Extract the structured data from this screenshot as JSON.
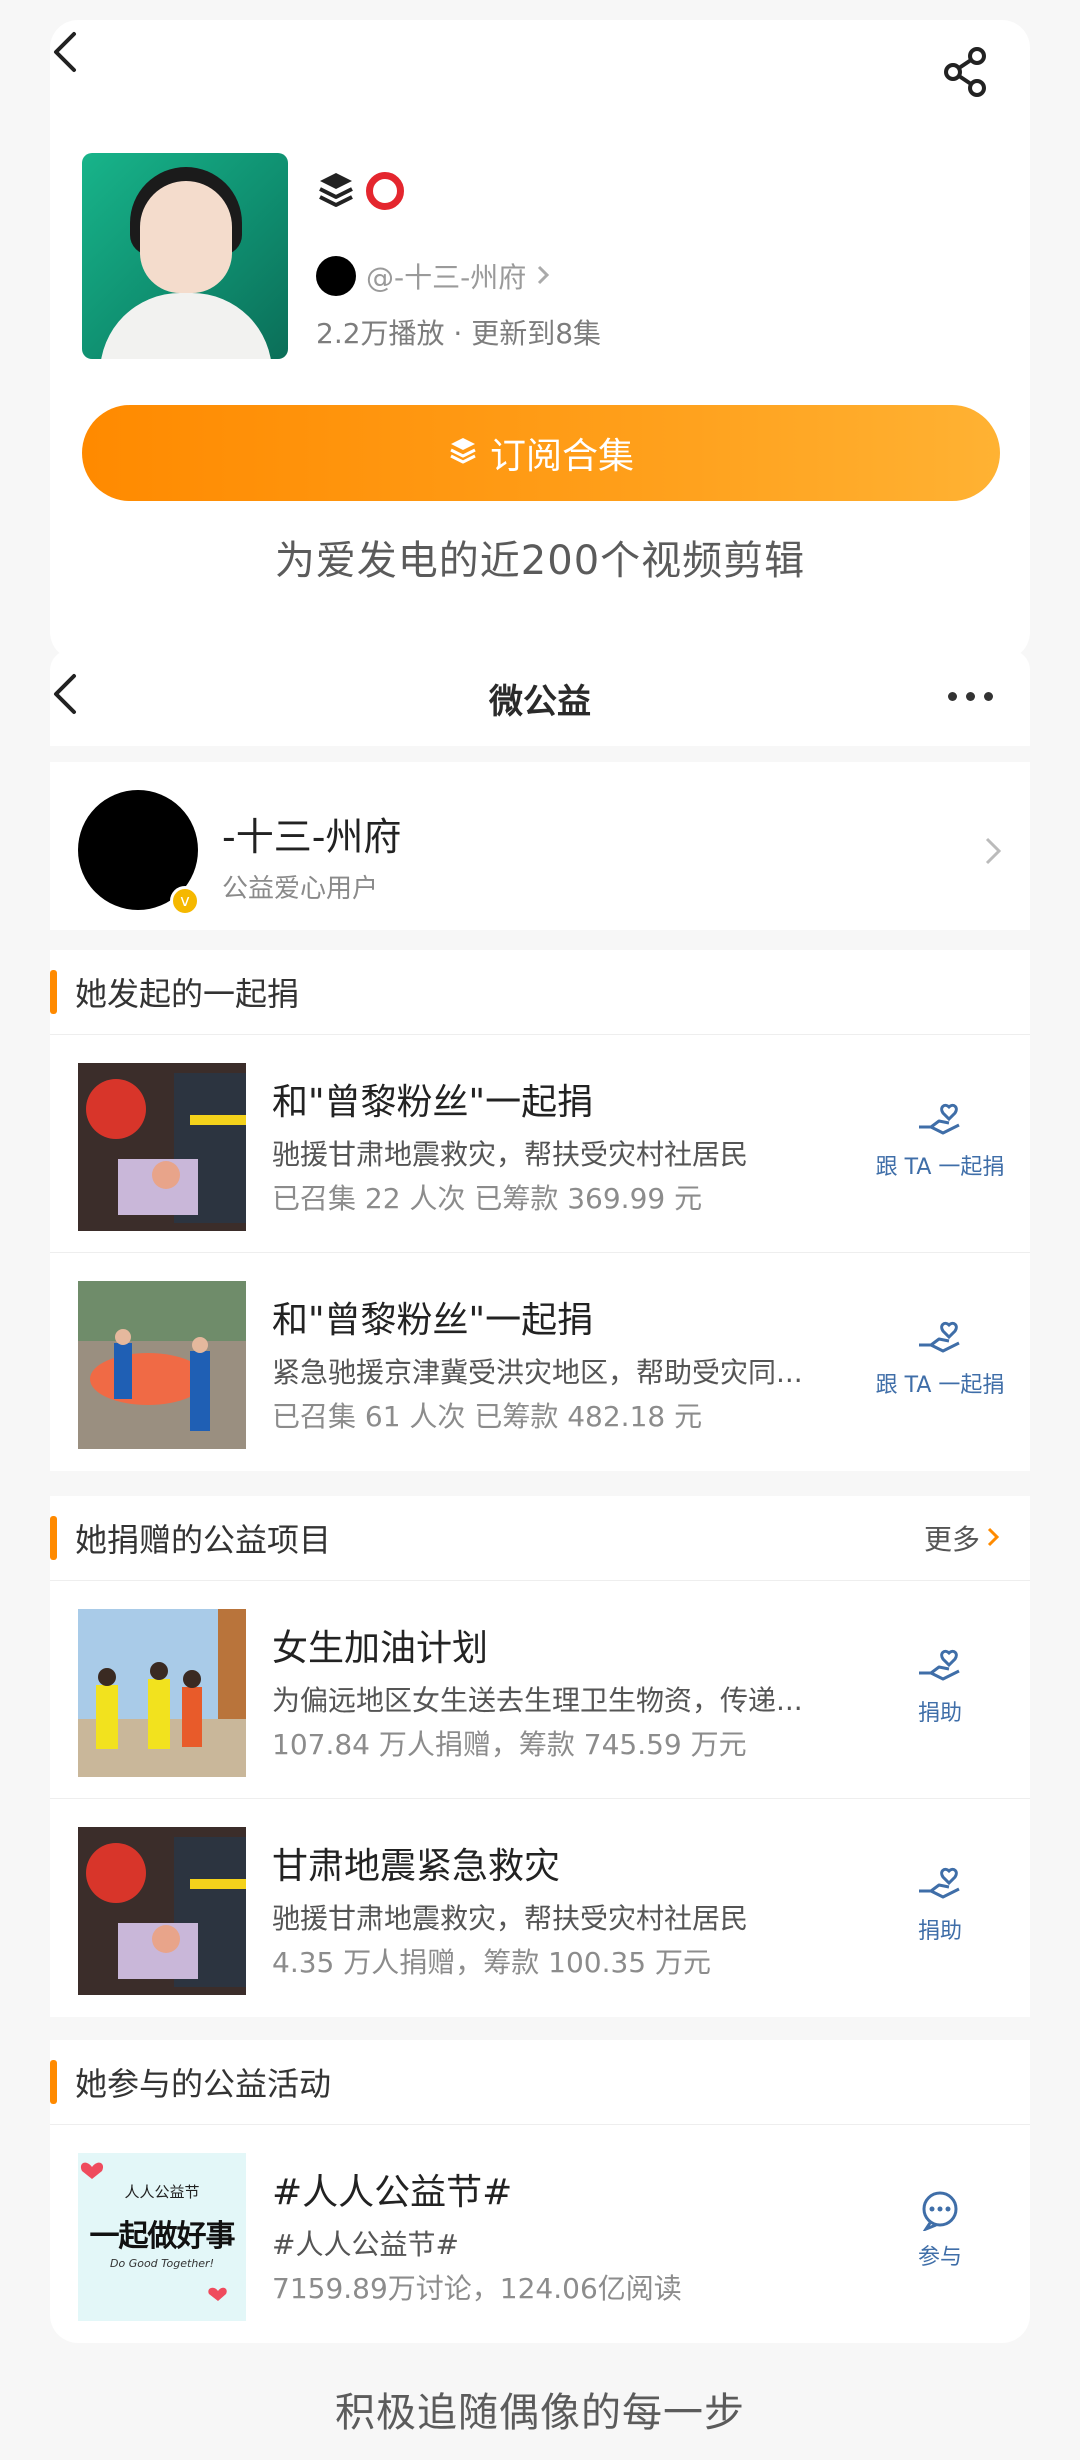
{
  "collection": {
    "author": "@-十三-州府",
    "meta": "2.2万播放 · 更新到8集",
    "subscribe_label": "订阅合集",
    "caption": "为爱发电的近200个视频剪辑"
  },
  "charity": {
    "nav_title": "微公益",
    "profile": {
      "name": "-十三-州府",
      "role": "公益爱心用户"
    },
    "sections": {
      "initiated": {
        "title": "她发起的一起捐"
      },
      "donated": {
        "title": "她捐赠的公益项目",
        "more": "更多"
      },
      "activities": {
        "title": "她参与的公益活动"
      }
    },
    "initiated_items": [
      {
        "title": "和\"曾黎粉丝\"一起捐",
        "desc": "驰援甘肃地震救灾，帮扶受灾村社居民",
        "stat": "已召集 22 人次  已筹款 369.99 元",
        "action": "跟 TA 一起捐"
      },
      {
        "title": "和\"曾黎粉丝\"一起捐",
        "desc": "紧急驰援京津冀受洪灾地区，帮助受灾同...",
        "stat": "已召集 61 人次  已筹款 482.18 元",
        "action": "跟 TA 一起捐"
      }
    ],
    "donated_items": [
      {
        "title": "女生加油计划",
        "desc": "为偏远地区女生送去生理卫生物资，传递...",
        "stat": "107.84 万人捐赠，筹款 745.59 万元",
        "action": "捐助"
      },
      {
        "title": "甘肃地震紧急救灾",
        "desc": "驰援甘肃地震救灾，帮扶受灾村社居民",
        "stat": "4.35 万人捐赠，筹款 100.35 万元",
        "action": "捐助"
      }
    ],
    "activity_items": [
      {
        "title": "#人人公益节#",
        "desc": "#人人公益节#",
        "stat": "7159.89万讨论，124.06亿阅读",
        "action": "参与",
        "thumb_badge": "人人公益节",
        "thumb_big": "一起做好事",
        "thumb_en": "Do Good Together!"
      }
    ]
  },
  "bottom_caption": "积极追随偶像的每一步",
  "colors": {
    "accent": "#ff8a00",
    "action_blue": "#3f6ea8",
    "ring_red": "#e4262e"
  }
}
